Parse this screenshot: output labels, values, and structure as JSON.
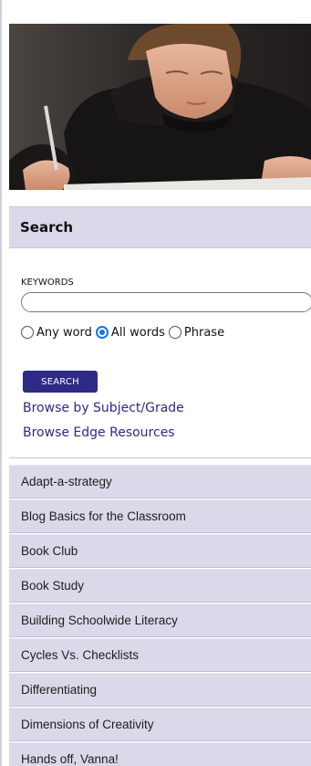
{
  "photo": {
    "alt": "student writing"
  },
  "search": {
    "heading": "Search",
    "keywords_label": "KEYWORDS",
    "keywords_value": "",
    "match_options": [
      "Any word",
      "All words",
      "Phrase"
    ],
    "selected_match": "All words",
    "button_label": "SEARCH",
    "links": [
      "Browse by Subject/Grade",
      "Browse Edge Resources"
    ]
  },
  "strategies": [
    "Adapt-a-strategy",
    "Blog Basics for the Classroom",
    "Book Club",
    "Book Study",
    "Building Schoolwide Literacy",
    "Cycles Vs. Checklists",
    "Differentiating",
    "Dimensions of Creativity",
    "Hands off, Vanna!"
  ],
  "colors": {
    "header_bg": "#dcd8ea",
    "accent": "#2e2a86",
    "radio_checked": "#1a73e8"
  }
}
